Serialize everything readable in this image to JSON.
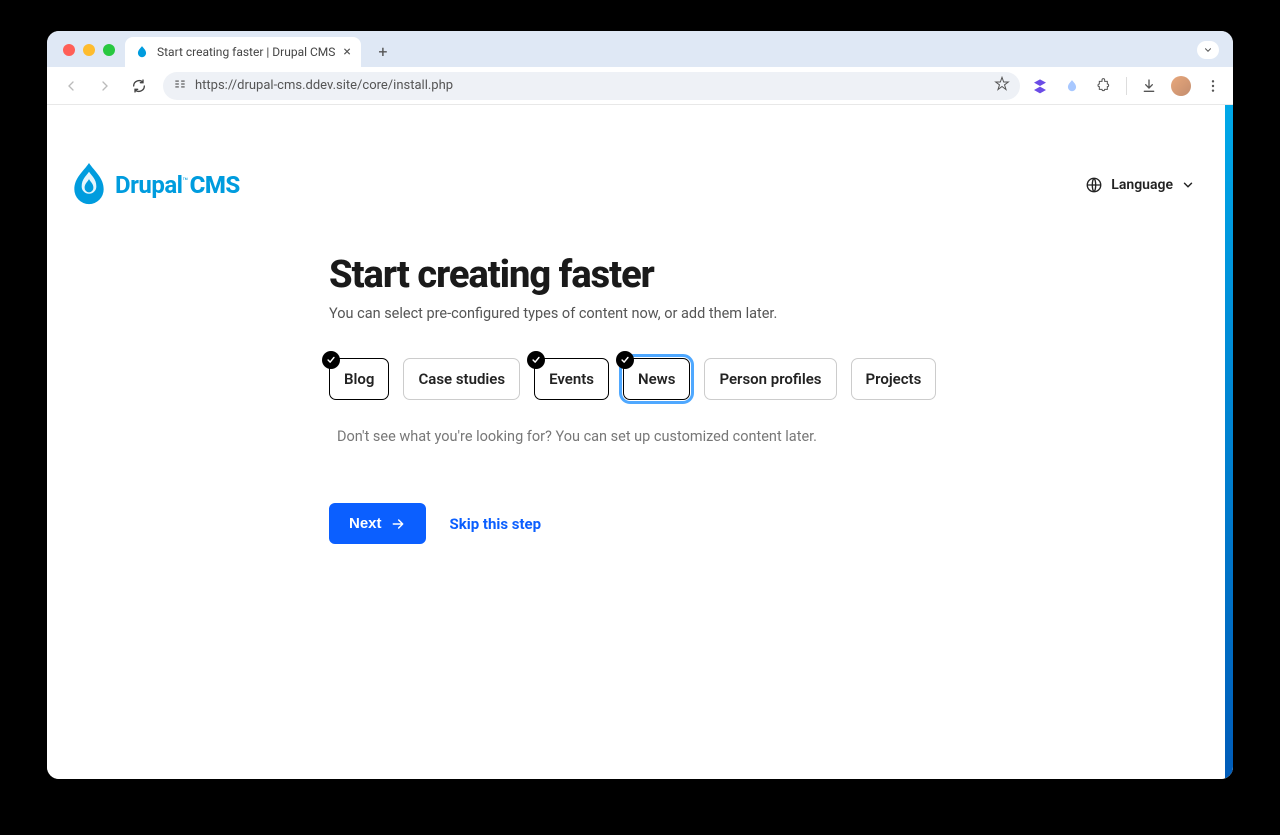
{
  "browser": {
    "tab_title": "Start creating faster | Drupal CMS",
    "url": "https://drupal-cms.ddev.site/core/install.php"
  },
  "header": {
    "logo_text_main": "Drupal",
    "logo_text_tm": "™",
    "logo_text_cms": "CMS",
    "language_label": "Language"
  },
  "main": {
    "title": "Start creating faster",
    "subtitle": "You can select pre-configured types of content now, or add them later.",
    "help_text": "Don't see what you're looking for? You can set up customized content later.",
    "chips": [
      {
        "label": "Blog",
        "selected": true,
        "focused": false
      },
      {
        "label": "Case studies",
        "selected": false,
        "focused": false
      },
      {
        "label": "Events",
        "selected": true,
        "focused": false
      },
      {
        "label": "News",
        "selected": true,
        "focused": true
      },
      {
        "label": "Person profiles",
        "selected": false,
        "focused": false
      },
      {
        "label": "Projects",
        "selected": false,
        "focused": false
      }
    ],
    "next_label": "Next",
    "skip_label": "Skip this step"
  },
  "colors": {
    "primary": "#0b5fff",
    "brand": "#009cde"
  }
}
